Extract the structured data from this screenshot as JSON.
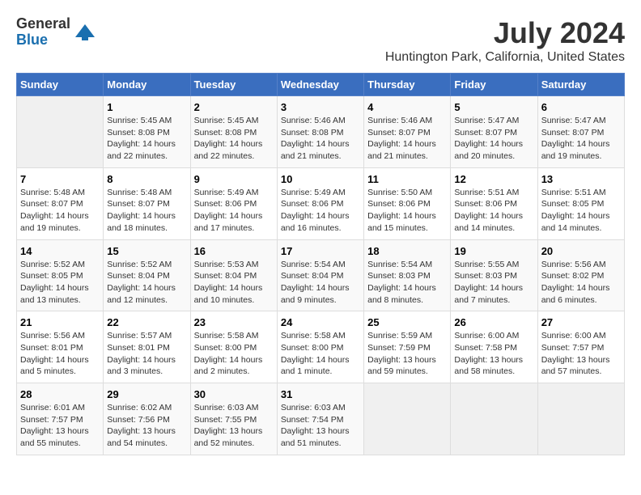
{
  "logo": {
    "general": "General",
    "blue": "Blue"
  },
  "header": {
    "month_year": "July 2024",
    "location": "Huntington Park, California, United States"
  },
  "days_of_week": [
    "Sunday",
    "Monday",
    "Tuesday",
    "Wednesday",
    "Thursday",
    "Friday",
    "Saturday"
  ],
  "weeks": [
    [
      {
        "day": "",
        "info": ""
      },
      {
        "day": "1",
        "info": "Sunrise: 5:45 AM\nSunset: 8:08 PM\nDaylight: 14 hours\nand 22 minutes."
      },
      {
        "day": "2",
        "info": "Sunrise: 5:45 AM\nSunset: 8:08 PM\nDaylight: 14 hours\nand 22 minutes."
      },
      {
        "day": "3",
        "info": "Sunrise: 5:46 AM\nSunset: 8:08 PM\nDaylight: 14 hours\nand 21 minutes."
      },
      {
        "day": "4",
        "info": "Sunrise: 5:46 AM\nSunset: 8:07 PM\nDaylight: 14 hours\nand 21 minutes."
      },
      {
        "day": "5",
        "info": "Sunrise: 5:47 AM\nSunset: 8:07 PM\nDaylight: 14 hours\nand 20 minutes."
      },
      {
        "day": "6",
        "info": "Sunrise: 5:47 AM\nSunset: 8:07 PM\nDaylight: 14 hours\nand 19 minutes."
      }
    ],
    [
      {
        "day": "7",
        "info": "Sunrise: 5:48 AM\nSunset: 8:07 PM\nDaylight: 14 hours\nand 19 minutes."
      },
      {
        "day": "8",
        "info": "Sunrise: 5:48 AM\nSunset: 8:07 PM\nDaylight: 14 hours\nand 18 minutes."
      },
      {
        "day": "9",
        "info": "Sunrise: 5:49 AM\nSunset: 8:06 PM\nDaylight: 14 hours\nand 17 minutes."
      },
      {
        "day": "10",
        "info": "Sunrise: 5:49 AM\nSunset: 8:06 PM\nDaylight: 14 hours\nand 16 minutes."
      },
      {
        "day": "11",
        "info": "Sunrise: 5:50 AM\nSunset: 8:06 PM\nDaylight: 14 hours\nand 15 minutes."
      },
      {
        "day": "12",
        "info": "Sunrise: 5:51 AM\nSunset: 8:06 PM\nDaylight: 14 hours\nand 14 minutes."
      },
      {
        "day": "13",
        "info": "Sunrise: 5:51 AM\nSunset: 8:05 PM\nDaylight: 14 hours\nand 14 minutes."
      }
    ],
    [
      {
        "day": "14",
        "info": "Sunrise: 5:52 AM\nSunset: 8:05 PM\nDaylight: 14 hours\nand 13 minutes."
      },
      {
        "day": "15",
        "info": "Sunrise: 5:52 AM\nSunset: 8:04 PM\nDaylight: 14 hours\nand 12 minutes."
      },
      {
        "day": "16",
        "info": "Sunrise: 5:53 AM\nSunset: 8:04 PM\nDaylight: 14 hours\nand 10 minutes."
      },
      {
        "day": "17",
        "info": "Sunrise: 5:54 AM\nSunset: 8:04 PM\nDaylight: 14 hours\nand 9 minutes."
      },
      {
        "day": "18",
        "info": "Sunrise: 5:54 AM\nSunset: 8:03 PM\nDaylight: 14 hours\nand 8 minutes."
      },
      {
        "day": "19",
        "info": "Sunrise: 5:55 AM\nSunset: 8:03 PM\nDaylight: 14 hours\nand 7 minutes."
      },
      {
        "day": "20",
        "info": "Sunrise: 5:56 AM\nSunset: 8:02 PM\nDaylight: 14 hours\nand 6 minutes."
      }
    ],
    [
      {
        "day": "21",
        "info": "Sunrise: 5:56 AM\nSunset: 8:01 PM\nDaylight: 14 hours\nand 5 minutes."
      },
      {
        "day": "22",
        "info": "Sunrise: 5:57 AM\nSunset: 8:01 PM\nDaylight: 14 hours\nand 3 minutes."
      },
      {
        "day": "23",
        "info": "Sunrise: 5:58 AM\nSunset: 8:00 PM\nDaylight: 14 hours\nand 2 minutes."
      },
      {
        "day": "24",
        "info": "Sunrise: 5:58 AM\nSunset: 8:00 PM\nDaylight: 14 hours\nand 1 minute."
      },
      {
        "day": "25",
        "info": "Sunrise: 5:59 AM\nSunset: 7:59 PM\nDaylight: 13 hours\nand 59 minutes."
      },
      {
        "day": "26",
        "info": "Sunrise: 6:00 AM\nSunset: 7:58 PM\nDaylight: 13 hours\nand 58 minutes."
      },
      {
        "day": "27",
        "info": "Sunrise: 6:00 AM\nSunset: 7:57 PM\nDaylight: 13 hours\nand 57 minutes."
      }
    ],
    [
      {
        "day": "28",
        "info": "Sunrise: 6:01 AM\nSunset: 7:57 PM\nDaylight: 13 hours\nand 55 minutes."
      },
      {
        "day": "29",
        "info": "Sunrise: 6:02 AM\nSunset: 7:56 PM\nDaylight: 13 hours\nand 54 minutes."
      },
      {
        "day": "30",
        "info": "Sunrise: 6:03 AM\nSunset: 7:55 PM\nDaylight: 13 hours\nand 52 minutes."
      },
      {
        "day": "31",
        "info": "Sunrise: 6:03 AM\nSunset: 7:54 PM\nDaylight: 13 hours\nand 51 minutes."
      },
      {
        "day": "",
        "info": ""
      },
      {
        "day": "",
        "info": ""
      },
      {
        "day": "",
        "info": ""
      }
    ]
  ]
}
